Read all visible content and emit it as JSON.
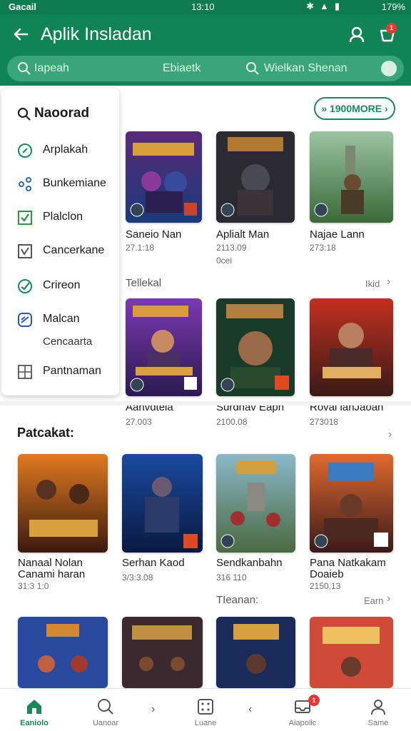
{
  "status_bar": {
    "carrier": "Gacail",
    "time": "13:10",
    "battery": "179%"
  },
  "app_bar": {
    "title": "Aplik Insladan",
    "cart_badge": "1"
  },
  "search": {
    "field1": "Iapeah",
    "field2": "Ebiaetk",
    "field3": "Wielkan Shenan"
  },
  "drawer": {
    "title": "Naoorad",
    "items": [
      {
        "label": "Arplakah",
        "icon": "compass-icon"
      },
      {
        "label": "Bunkemiane",
        "icon": "share-icon"
      },
      {
        "label": "Plalclon",
        "icon": "checkbox-icon"
      },
      {
        "label": "Cancerkane",
        "icon": "check-square-icon"
      },
      {
        "label": "Crireon",
        "icon": "check-circle-icon"
      },
      {
        "label": "Malcan",
        "icon": "gauge-icon"
      },
      {
        "label": "Pantnaman",
        "icon": "grid-icon"
      }
    ],
    "sub_label": "Cencaarta"
  },
  "all_button": "» 1900MORE ›",
  "cards_row1": [
    {
      "title": "Saneio Nan",
      "sub": "27.1:18",
      "sub2": ""
    },
    {
      "title": "Aplialt Man",
      "sub": "2113.09",
      "sub2": "0cei"
    },
    {
      "title": "Najae Lann",
      "sub": "273:18",
      "sub2": ""
    }
  ],
  "section1": {
    "label": "Tellekal",
    "more": "Ikid"
  },
  "cards_row2": [
    {
      "title": "Aahvdtela",
      "sub": "27.003",
      "sub2": ""
    },
    {
      "title": "Surdhav Eaph",
      "sub": "2100.08",
      "sub2": ""
    },
    {
      "title": "Roval lahJaoan",
      "sub": "273018",
      "sub2": ""
    }
  ],
  "section2": {
    "heading": "Patcakat:"
  },
  "cards_row3": [
    {
      "title": "Nanaal Nolan",
      "sub": "Canami haran",
      "sub2": "31:3 1:0"
    },
    {
      "title": "Serhan Kaod",
      "sub": "3/3:3.08",
      "sub2": ""
    },
    {
      "title": "Sendkanbahn",
      "sub": "316 110",
      "sub2": ""
    },
    {
      "title": "Pana Natkakam",
      "sub": "Doaieb",
      "sub2": "2150.13"
    }
  ],
  "section3": {
    "label": "TIeanan:",
    "more": "Earn"
  },
  "bottom_nav": {
    "items": [
      {
        "label": "Eaniolo",
        "icon": "home-icon",
        "active": true
      },
      {
        "label": "Uanoar",
        "icon": "search-icon",
        "active": false
      },
      {
        "label": "Luane",
        "icon": "dice-icon",
        "active": false
      },
      {
        "label": "Aiapolic",
        "icon": "inbox-icon",
        "active": false,
        "badge": "1"
      },
      {
        "label": "Same",
        "icon": "user-icon",
        "active": false
      }
    ]
  },
  "colors": {
    "primary": "#118454",
    "accent": "#1a8a5a",
    "badge": "#e53935"
  }
}
